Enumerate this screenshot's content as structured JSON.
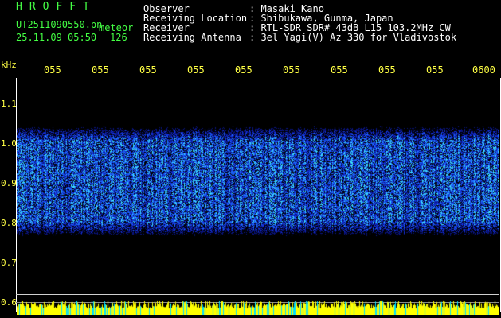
{
  "header": {
    "title": "HROFFT",
    "file_name": "UT2511090550.pn",
    "meteor_label": "meteor",
    "date_time": "25.11.09 05:50",
    "count": "126"
  },
  "info": [
    {
      "label": "Observer",
      "value": ": Masaki Kano"
    },
    {
      "label": "Receiving Location",
      "value": ": Shibukawa, Gunma, Japan"
    },
    {
      "label": "Receiver",
      "value": ": RTL-SDR SDR# 43dB L15 103.2MHz CW"
    },
    {
      "label": "Receiving Antenna",
      "value": ": 3el Yagi(V) Az 330 for Vladivostok"
    }
  ],
  "axis": {
    "y_unit": "kHz",
    "y_ticks": [
      "1.1",
      "1.0",
      "0.9",
      "0.8",
      "0.7",
      "0.6"
    ],
    "x_ticks": [
      "055",
      "055",
      "055",
      "055",
      "055",
      "055",
      "055",
      "055",
      "055",
      "0600"
    ]
  },
  "colors": {
    "background": "#000000",
    "title": "#44ff44",
    "axis_labels": "#ffff44",
    "spectrum": "#2060ff",
    "amplitude": "#ffff00"
  },
  "spectrum": {
    "band_khz": [
      0.78,
      1.03
    ],
    "peak_khz": 0.9
  }
}
